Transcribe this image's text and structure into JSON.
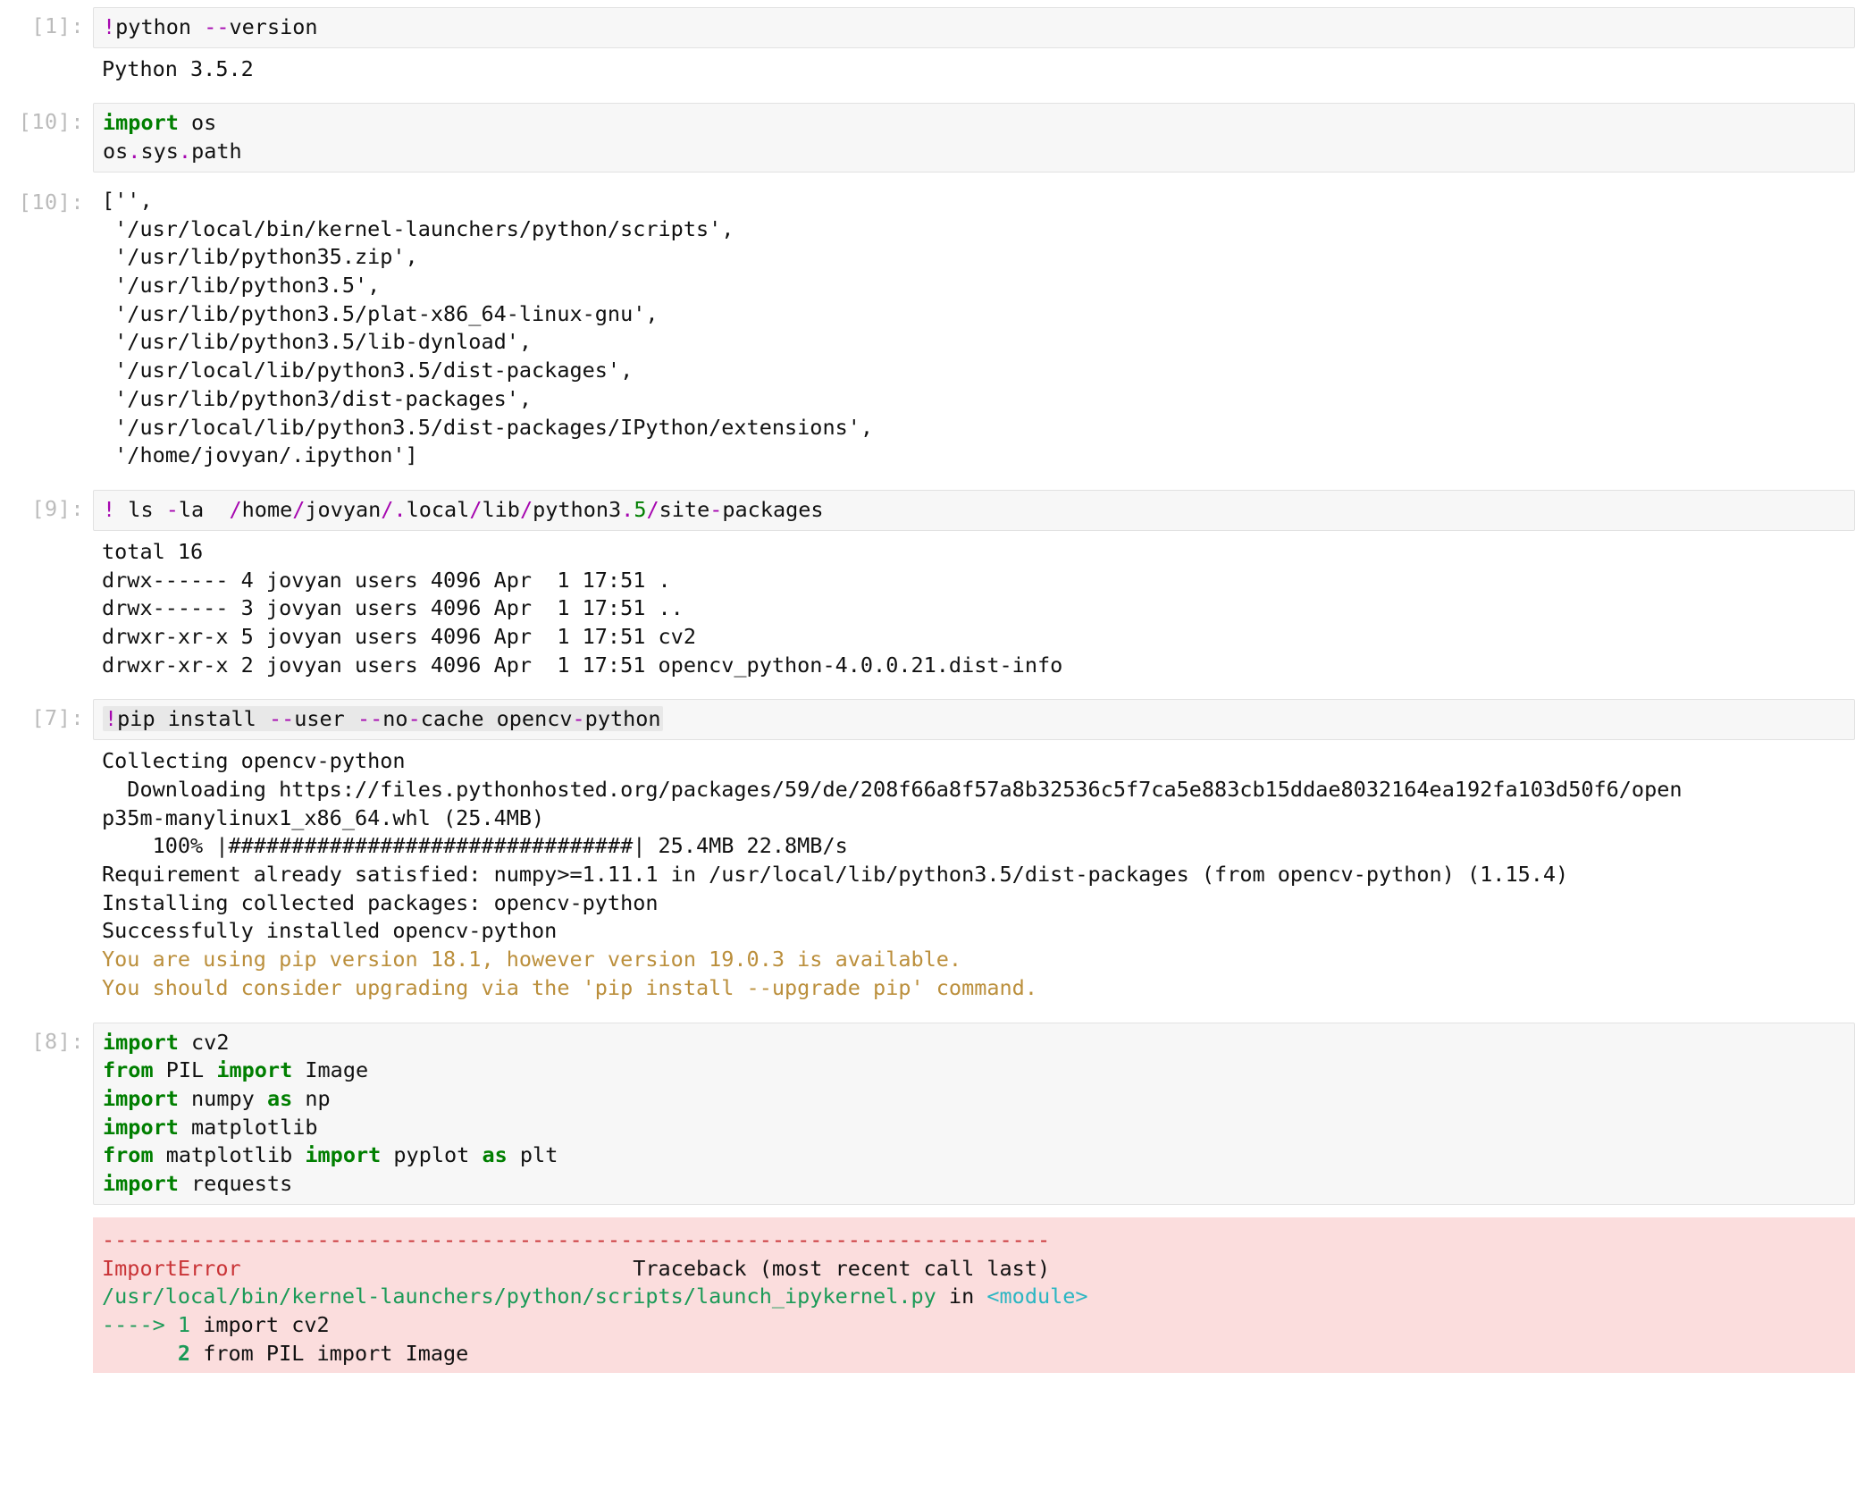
{
  "cells": {
    "c1": {
      "prompt": "[1]:",
      "code_html": "<span class='tk-purple'>!</span>python <span class='tk-dash'>--</span>version",
      "output": "Python 3.5.2"
    },
    "c2": {
      "prompt": "[10]:",
      "code_html": "<span class='tk-bold-green'>import</span> os\nos<span class='tk-purple'>.</span>sys<span class='tk-purple'>.</span>path"
    },
    "c3": {
      "prompt": "[10]:",
      "output": "['',\n '/usr/local/bin/kernel-launchers/python/scripts',\n '/usr/lib/python35.zip',\n '/usr/lib/python3.5',\n '/usr/lib/python3.5/plat-x86_64-linux-gnu',\n '/usr/lib/python3.5/lib-dynload',\n '/usr/local/lib/python3.5/dist-packages',\n '/usr/lib/python3/dist-packages',\n '/usr/local/lib/python3.5/dist-packages/IPython/extensions',\n '/home/jovyan/.ipython']"
    },
    "c4": {
      "prompt": "[9]:",
      "code_html": "<span class='tk-purple'>!</span> ls <span class='tk-dash'>-</span>la  <span class='tk-purple'>/</span>home<span class='tk-purple'>/</span>jovyan<span class='tk-purple'>/.</span>local<span class='tk-purple'>/</span>lib<span class='tk-purple'>/</span>python3<span class='tk-purple'>.</span><span class='tk-green'>5</span><span class='tk-purple'>/</span>site<span class='tk-dash'>-</span>packages",
      "output": "total 16\ndrwx------ 4 jovyan users 4096 Apr  1 17:51 .\ndrwx------ 3 jovyan users 4096 Apr  1 17:51 ..\ndrwxr-xr-x 5 jovyan users 4096 Apr  1 17:51 cv2\ndrwxr-xr-x 2 jovyan users 4096 Apr  1 17:51 opencv_python-4.0.0.21.dist-info"
    },
    "c5": {
      "prompt": "[7]:",
      "code_html": "<span class='selected'><span class='tk-purple'>!</span>pip install <span class='tk-dash'>--</span>user <span class='tk-dash'>--</span>no<span class='tk-dash'>-</span>cache opencv<span class='tk-dash'>-</span>python</span>",
      "out_plain": "Collecting opencv-python\n  Downloading https://files.pythonhosted.org/packages/59/de/208f66a8f57a8b32536c5f7ca5e883cb15ddae8032164ea192fa103d50f6/open\np35m-manylinux1_x86_64.whl (25.4MB)\n    100% |################################| 25.4MB 22.8MB/s\nRequirement already satisfied: numpy>=1.11.1 in /usr/local/lib/python3.5/dist-packages (from opencv-python) (1.15.4)\nInstalling collected packages: opencv-python\nSuccessfully installed opencv-python",
      "out_warn": "You are using pip version 18.1, however version 19.0.3 is available.\nYou should consider upgrading via the 'pip install --upgrade pip' command."
    },
    "c6": {
      "prompt": "[8]:",
      "code_html": "<span class='tk-bold-green'>import</span> cv2\n<span class='tk-bold-green'>from</span> PIL <span class='tk-bold-green'>import</span> Image\n<span class='tk-bold-green'>import</span> numpy <span class='tk-bold-green'>as</span> np\n<span class='tk-bold-green'>import</span> matplotlib\n<span class='tk-bold-green'>from</span> matplotlib <span class='tk-bold-green'>import</span> pyplot <span class='tk-bold-green'>as</span> plt\n<span class='tk-bold-green'>import</span> requests",
      "err_dashes": "---------------------------------------------------------------------------",
      "err_name": "ImportError",
      "err_trail": "                               Traceback (most recent call last)",
      "err_file": "/usr/local/bin/kernel-launchers/python/scripts/launch_ipykernel.py",
      "err_in": " in ",
      "err_module": "<module>",
      "err_l1a": "----> 1",
      "err_l1b": " import cv2",
      "err_l2a": "      2",
      "err_l2b": " from PIL import Image"
    }
  }
}
